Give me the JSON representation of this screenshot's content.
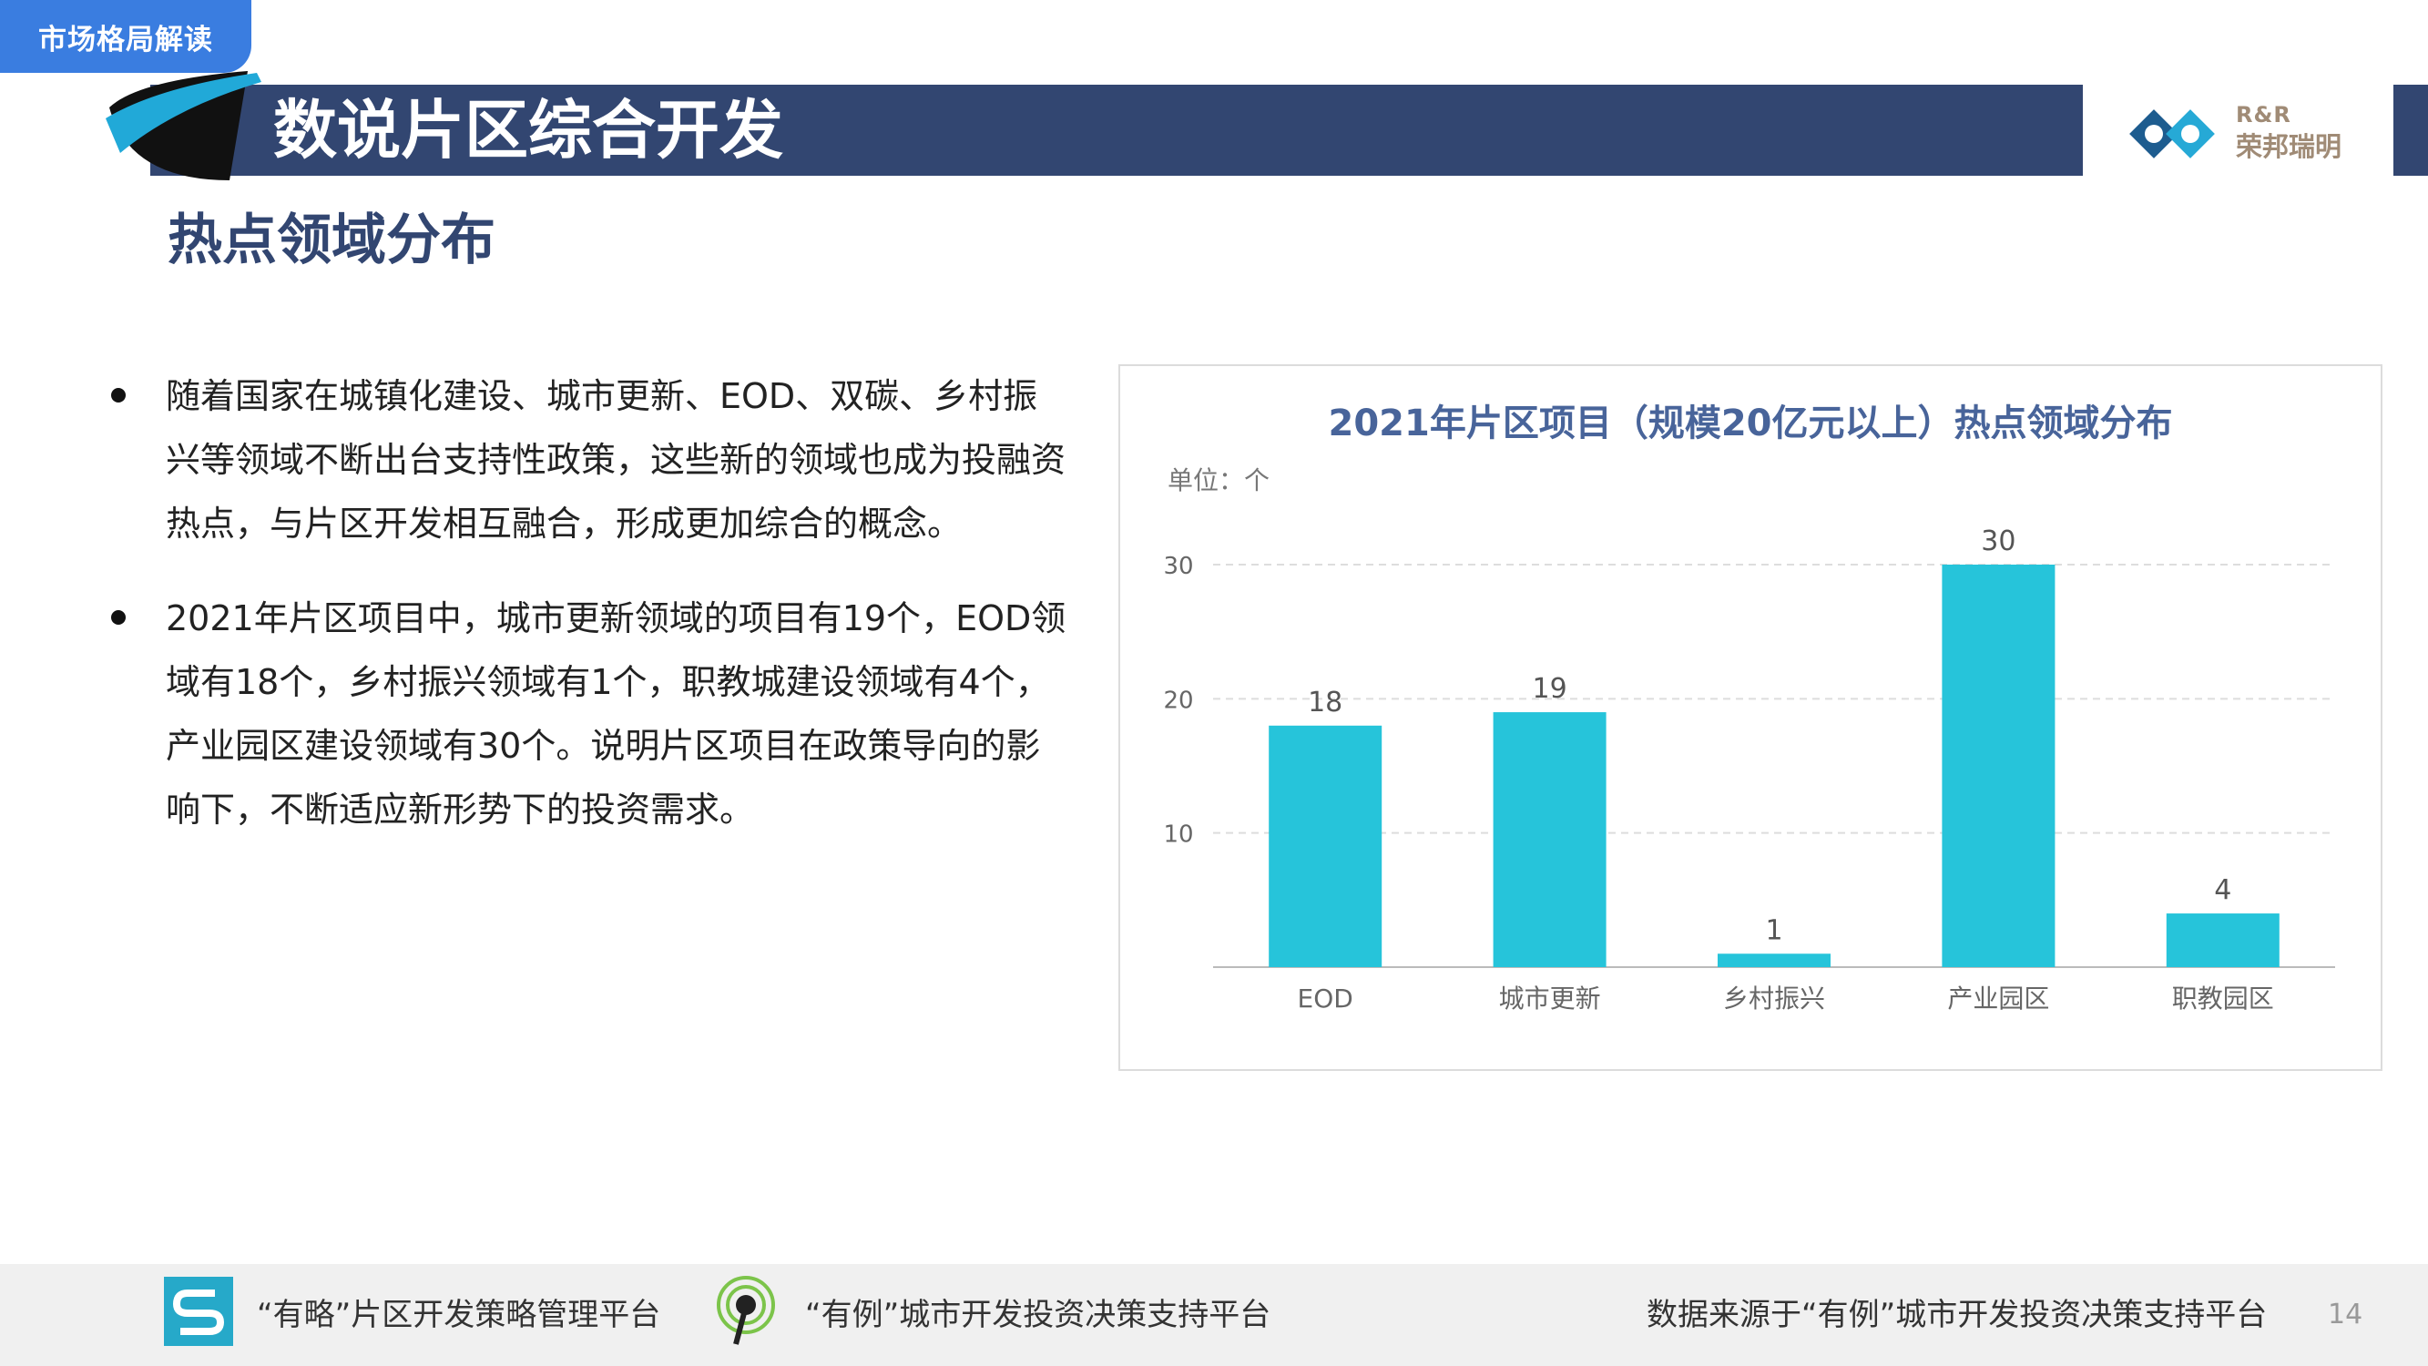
{
  "header": {
    "tag": "市场格局解读",
    "title": "数说片区综合开发",
    "subtitle": "热点领域分布",
    "logo_top": "R&R",
    "logo_bottom": "荣邦瑞明"
  },
  "bullets": [
    "随着国家在城镇化建设、城市更新、EOD、双碳、乡村振兴等领域不断出台支持性政策，这些新的领域也成为投融资热点，与片区开发相互融合，形成更加综合的概念。",
    "2021年片区项目中，城市更新领域的项目有19个，EOD领域有18个，乡村振兴领域有1个，职教城建设领域有4个，产业园区建设领域有30个。说明片区项目在政策导向的影响下，不断适应新形势下的投资需求。"
  ],
  "chart_data": {
    "type": "bar",
    "title": "2021年片区项目（规模20亿元以上）热点领域分布",
    "unit": "单位：个",
    "categories": [
      "EOD",
      "城市更新",
      "乡村振兴",
      "产业园区",
      "职教园区"
    ],
    "values": [
      18,
      19,
      1,
      30,
      4
    ],
    "yticks": [
      10,
      20,
      30
    ],
    "ylim": [
      0,
      30
    ],
    "grid": true,
    "bar_color": "#26c4da"
  },
  "footer": {
    "platform1": "“有略”片区开发策略管理平台",
    "platform2": "“有例”城市开发投资决策支持平台",
    "source": "数据来源于“有例”城市开发投资决策支持平台",
    "page": "14"
  }
}
